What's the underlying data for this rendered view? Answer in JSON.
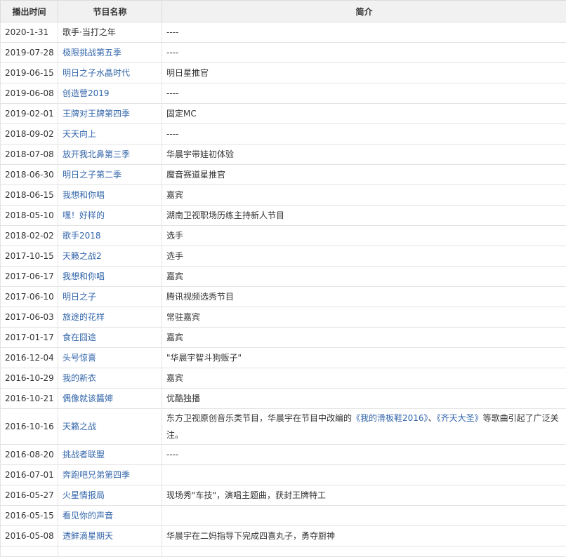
{
  "headers": {
    "date": "播出时间",
    "name": "节目名称",
    "desc": "简介"
  },
  "rows": [
    {
      "date": "2020-1-31",
      "name": "歌手·当打之年",
      "desc": "----",
      "link": false
    },
    {
      "date": "2019-07-28",
      "name": "极限挑战第五季",
      "desc": "----",
      "link": true
    },
    {
      "date": "2019-06-15",
      "name": "明日之子水晶时代",
      "desc": "明日星推官",
      "link": true
    },
    {
      "date": "2019-06-08",
      "name": "创造营2019",
      "desc": "----",
      "link": true
    },
    {
      "date": "2019-02-01",
      "name": "王牌对王牌第四季",
      "desc": "固定MC",
      "link": true
    },
    {
      "date": "2018-09-02",
      "name": "天天向上",
      "desc": "----",
      "link": true
    },
    {
      "date": "2018-07-08",
      "name": "放开我北鼻第三季",
      "desc": "华晨宇带娃初体验",
      "link": true
    },
    {
      "date": "2018-06-30",
      "name": "明日之子第二季",
      "desc": "魔音赛道星推官",
      "link": true
    },
    {
      "date": "2018-06-15",
      "name": "我想和你唱",
      "desc": "嘉宾",
      "link": true
    },
    {
      "date": "2018-05-10",
      "name": "嘿！好样的",
      "desc": "湖南卫视职场历练主持新人节目",
      "link": true
    },
    {
      "date": "2018-02-02",
      "name": "歌手2018",
      "desc": "选手",
      "link": true
    },
    {
      "date": "2017-10-15",
      "name": "天籁之战2",
      "desc": "选手",
      "link": true
    },
    {
      "date": "2017-06-17",
      "name": "我想和你唱",
      "desc": "嘉宾",
      "link": true
    },
    {
      "date": "2017-06-10",
      "name": "明日之子",
      "desc": "腾讯视频选秀节目",
      "link": true
    },
    {
      "date": "2017-06-03",
      "name": "旅途的花样",
      "desc": "常驻嘉宾",
      "link": true
    },
    {
      "date": "2017-01-17",
      "name": "食在囧途",
      "desc": "嘉宾",
      "link": true
    },
    {
      "date": "2016-12-04",
      "name": "头号惊喜",
      "desc": "\"华晨宇智斗狗贩子\"",
      "link": true
    },
    {
      "date": "2016-10-29",
      "name": "我的新衣",
      "desc": "嘉宾",
      "link": true
    },
    {
      "date": "2016-10-21",
      "name": "偶像就该醬婶",
      "desc": "优酷独播",
      "link": true
    },
    {
      "date": "2016-10-16",
      "name": "天籁之战",
      "desc_parts": [
        "东方卫视原创音乐类节目，华晨宇在节目中改编的",
        "《我的滑板鞋2016》",
        "、",
        "《齐天大圣》",
        "等歌曲引起了广泛关注。"
      ],
      "link": true,
      "tall": true
    },
    {
      "date": "2016-08-20",
      "name": "挑战者联盟",
      "desc": "----",
      "link": true
    },
    {
      "date": "2016-07-01",
      "name": "奔跑吧兄弟第四季",
      "desc": "",
      "link": true
    },
    {
      "date": "2016-05-27",
      "name": "火星情报局",
      "desc": "现场秀\"车技\"，演唱主题曲，获封王牌特工",
      "link": true
    },
    {
      "date": "2016-05-15",
      "name": "看见你的声音",
      "desc": "",
      "link": true
    },
    {
      "date": "2016-05-08",
      "name": "透鲜滴星期天",
      "desc": "华晨宇在二妈指导下完成四喜丸子，勇夺厨神",
      "link": true
    }
  ]
}
